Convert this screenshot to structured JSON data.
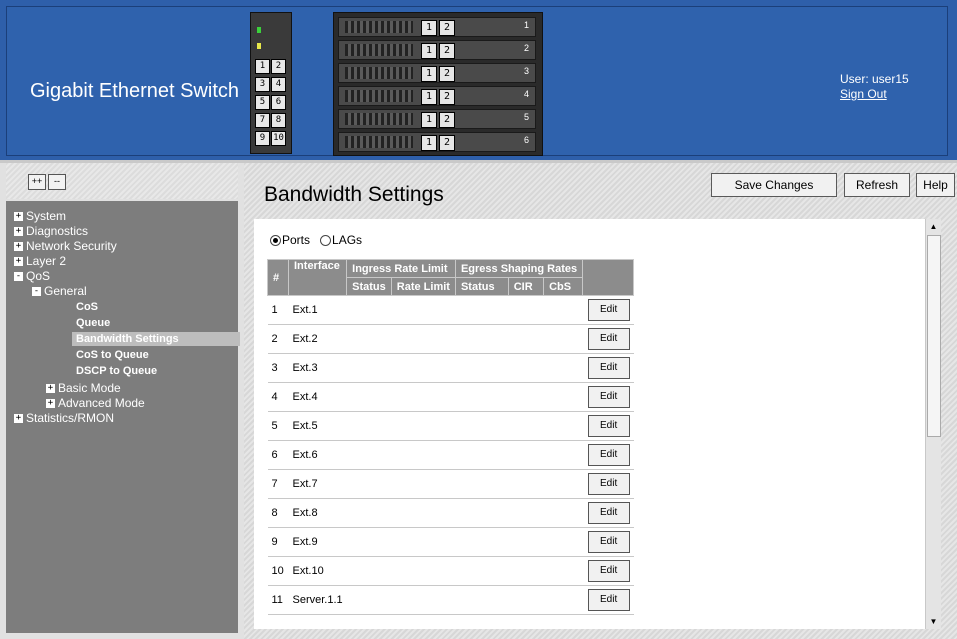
{
  "header": {
    "title": "Gigabit Ethernet Switch",
    "user_label": "User: user15",
    "signout_label": "Sign Out",
    "port_labels": [
      "1",
      "2",
      "3",
      "4",
      "5",
      "6",
      "7",
      "8",
      "9",
      "10"
    ],
    "blade_buttons": [
      "1",
      "2"
    ],
    "blade_numbers": [
      "1",
      "2",
      "3",
      "4",
      "5",
      "6"
    ]
  },
  "sidebar": {
    "expand_all": "++",
    "collapse_all": "--",
    "items": [
      {
        "label": "System",
        "level": 0,
        "state": "+"
      },
      {
        "label": "Diagnostics",
        "level": 0,
        "state": "+"
      },
      {
        "label": "Network Security",
        "level": 0,
        "state": "+"
      },
      {
        "label": "Layer 2",
        "level": 0,
        "state": "+"
      },
      {
        "label": "QoS",
        "level": 0,
        "state": "-"
      },
      {
        "label": "General",
        "level": 1,
        "state": "-"
      },
      {
        "label": "CoS",
        "level": 2
      },
      {
        "label": "Queue",
        "level": 2
      },
      {
        "label": "Bandwidth Settings",
        "level": 2,
        "selected": true
      },
      {
        "label": "CoS to Queue",
        "level": 2
      },
      {
        "label": "DSCP to Queue",
        "level": 2
      },
      {
        "label": "Basic Mode",
        "level": 1,
        "state": "+"
      },
      {
        "label": "Advanced Mode",
        "level": 1,
        "state": "+"
      },
      {
        "label": "Statistics/RMON",
        "level": 0,
        "state": "+"
      }
    ]
  },
  "main": {
    "title": "Bandwidth Settings",
    "save_label": "Save Changes",
    "refresh_label": "Refresh",
    "help_label": "Help",
    "radio_ports": "Ports",
    "radio_lags": "LAGs",
    "selected_radio": "Ports",
    "table": {
      "headers": {
        "num": "#",
        "interface": "Interface",
        "ingress": "Ingress Rate Limit",
        "egress": "Egress Shaping Rates",
        "status": "Status",
        "rate_limit": "Rate Limit",
        "egress_status": "Status",
        "cir": "CIR",
        "cbs": "CbS"
      },
      "edit_label": "Edit",
      "rows": [
        {
          "num": "1",
          "interface": "Ext.1"
        },
        {
          "num": "2",
          "interface": "Ext.2"
        },
        {
          "num": "3",
          "interface": "Ext.3"
        },
        {
          "num": "4",
          "interface": "Ext.4"
        },
        {
          "num": "5",
          "interface": "Ext.5"
        },
        {
          "num": "6",
          "interface": "Ext.6"
        },
        {
          "num": "7",
          "interface": "Ext.7"
        },
        {
          "num": "8",
          "interface": "Ext.8"
        },
        {
          "num": "9",
          "interface": "Ext.9"
        },
        {
          "num": "10",
          "interface": "Ext.10"
        },
        {
          "num": "11",
          "interface": "Server.1.1"
        }
      ]
    }
  },
  "colors": {
    "header_bg": "#2e5faa",
    "sidebar_tree_bg": "#7d7d7d",
    "table_header_bg": "#8c8c8c"
  }
}
